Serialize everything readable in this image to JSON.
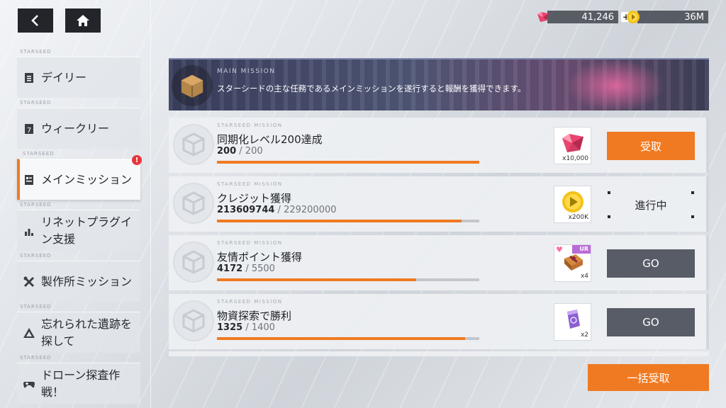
{
  "currency": {
    "gems": "41,246",
    "gems_plus": "+",
    "coins": "36M"
  },
  "sidebar": {
    "tag": "STARSEED",
    "items": [
      {
        "label": "デイリー",
        "icon": "daily-icon"
      },
      {
        "label": "ウィークリー",
        "icon": "weekly-icon"
      },
      {
        "label": "メインミッション",
        "icon": "main-mission-icon",
        "active": true,
        "alert": "!"
      },
      {
        "label": "リネットプラグイン支援",
        "icon": "plugin-icon"
      },
      {
        "label": "製作所ミッション",
        "icon": "tools-icon"
      },
      {
        "label": "忘れられた遺跡を探して",
        "icon": "ruins-icon"
      },
      {
        "label": "ドローン探査作戦！",
        "icon": "gamepad-icon"
      }
    ]
  },
  "banner": {
    "subtitle": "MAIN MISSION",
    "description": "スターシードの主な任務であるメインミッションを遂行すると報酬を獲得できます。"
  },
  "mission_tag": "STARSEED MISSION",
  "missions": [
    {
      "title": "同期化レベル200達成",
      "current": "200",
      "sep": " / ",
      "total": "200",
      "progress": 1.0,
      "reward_icon": "gem-icon",
      "reward_qty": "x10,000",
      "button": "受取",
      "state": "claim"
    },
    {
      "title": "クレジット獲得",
      "current": "213609744",
      "sep": " / ",
      "total": "229200000",
      "progress": 0.932,
      "reward_icon": "coin-icon",
      "reward_qty": "x200K",
      "button": "進行中",
      "state": "progress"
    },
    {
      "title": "友情ポイント獲得",
      "current": "4172",
      "sep": " / ",
      "total": "5500",
      "progress": 0.759,
      "reward_icon": "gift-box-icon",
      "reward_qty": "x4",
      "reward_badge": "UR",
      "button": "GO",
      "state": "go"
    },
    {
      "title": "物資探索で勝利",
      "current": "1325",
      "sep": " / ",
      "total": "1400",
      "progress": 0.946,
      "reward_icon": "supply-pack-icon",
      "reward_qty": "x2",
      "button": "GO",
      "state": "go"
    }
  ],
  "claim_all": "一括受取",
  "colors": {
    "accent": "#f07a22",
    "dark_button": "#585c66",
    "top_button": "#23252b"
  }
}
